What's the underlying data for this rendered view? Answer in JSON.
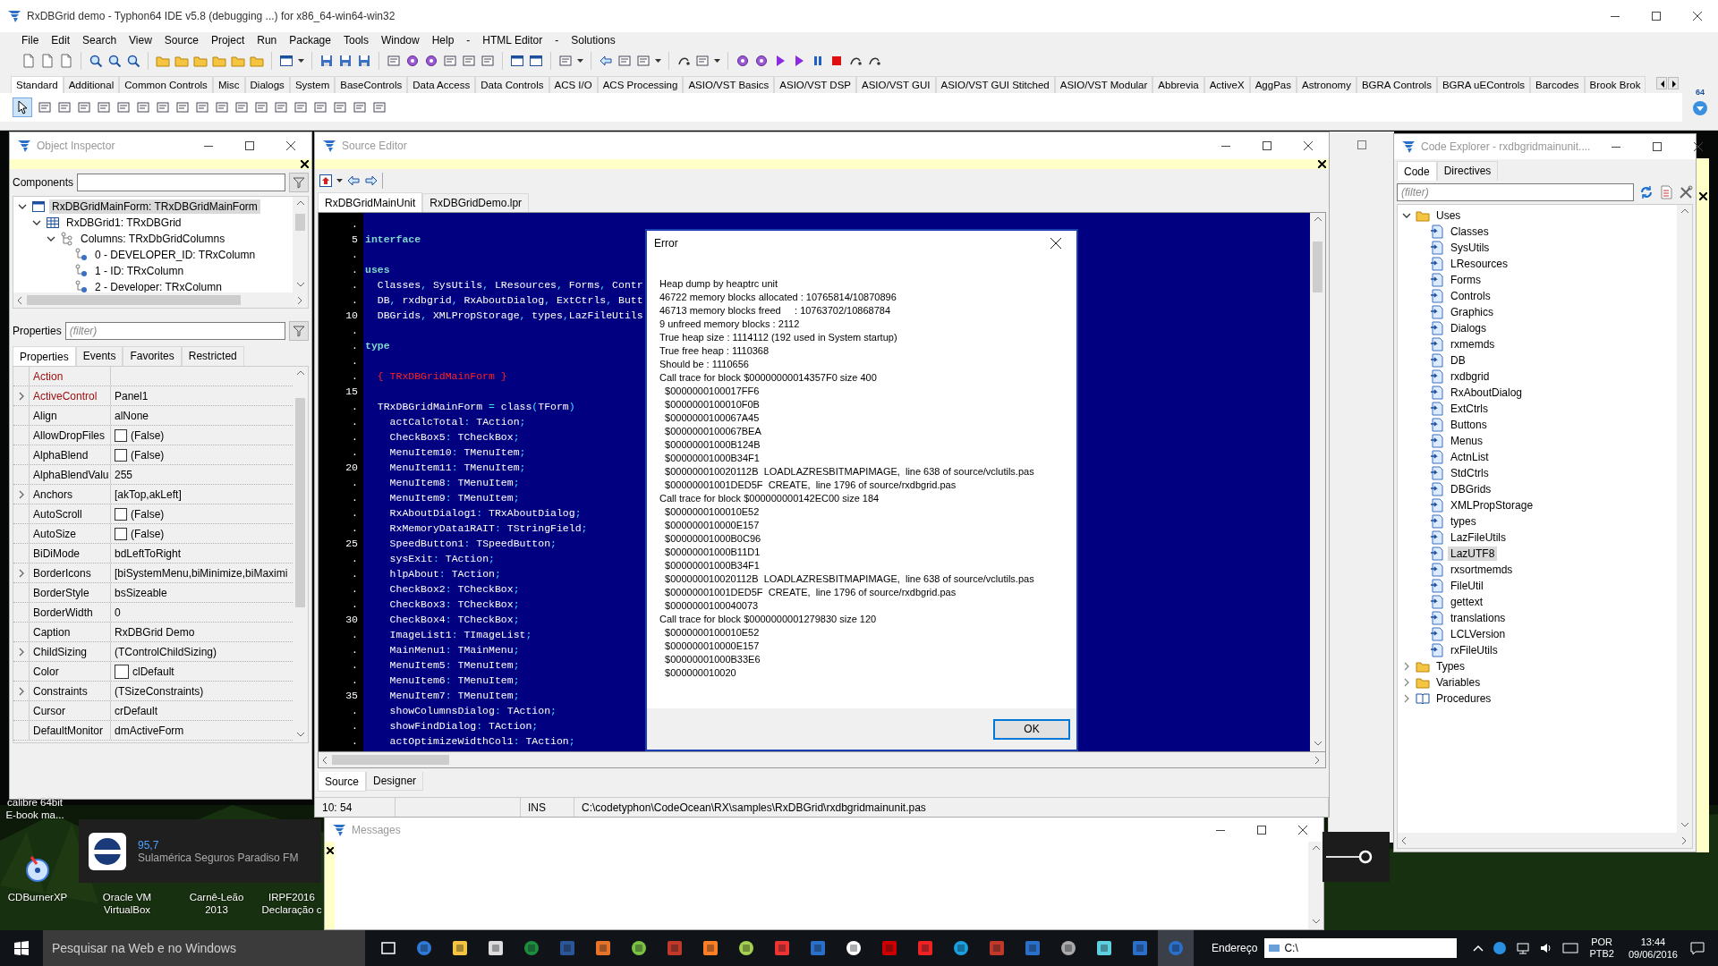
{
  "ide": {
    "title": "RxDBGrid demo - Typhon64 IDE v5.8 (debugging ...) for x86_64-win64-win32",
    "menu": [
      "File",
      "Edit",
      "Search",
      "View",
      "Source",
      "Project",
      "Run",
      "Package",
      "Tools",
      "Window",
      "Help",
      "-",
      "HTML Editor",
      "-",
      "Solutions"
    ],
    "palette_tabs": [
      {
        "label": "Standard",
        "selected": true
      },
      {
        "label": "Additional",
        "selected": false
      },
      {
        "label": "Common Controls",
        "selected": false
      },
      {
        "label": "Misc",
        "selected": false
      },
      {
        "label": "Dialogs",
        "selected": false
      },
      {
        "label": "System",
        "selected": false
      },
      {
        "label": "BaseControls",
        "selected": false
      },
      {
        "label": "Data Access",
        "selected": false
      },
      {
        "label": "Data Controls",
        "selected": false
      },
      {
        "label": "ACS I/O",
        "selected": false
      },
      {
        "label": "ACS Processing",
        "selected": false
      },
      {
        "label": "ASIO/VST Basics",
        "selected": false
      },
      {
        "label": "ASIO/VST DSP",
        "selected": false
      },
      {
        "label": "ASIO/VST GUI",
        "selected": false
      },
      {
        "label": "ASIO/VST GUI Stitched",
        "selected": false
      },
      {
        "label": "ASIO/VST Modular",
        "selected": false
      },
      {
        "label": "Abbrevia",
        "selected": false
      },
      {
        "label": "ActiveX",
        "selected": false
      },
      {
        "label": "AggPas",
        "selected": false
      },
      {
        "label": "Astronomy",
        "selected": false
      },
      {
        "label": "BGRA Controls",
        "selected": false
      },
      {
        "label": "BGRA uEControls",
        "selected": false
      },
      {
        "label": "Barcodes",
        "selected": false
      },
      {
        "label": "Brook Brok",
        "selected": false
      }
    ],
    "badge": "64"
  },
  "object_inspector": {
    "title": "Object Inspector",
    "components_label": "Components",
    "tree": [
      {
        "label": "RxDBGridMainForm: TRxDBGridMainForm",
        "kind": "form",
        "selected": true,
        "expanded": true,
        "children": [
          {
            "label": "RxDBGrid1: TRxDBGrid",
            "kind": "grid",
            "selected": false,
            "expanded": true,
            "children": [
              {
                "label": "Columns: TRxDbGridColumns",
                "kind": "collection",
                "selected": false,
                "expanded": true,
                "children": [
                  {
                    "label": "0 - DEVELOPER_ID: TRxColumn",
                    "kind": "column",
                    "selected": false
                  },
                  {
                    "label": "1 - ID: TRxColumn",
                    "kind": "column",
                    "selected": false
                  },
                  {
                    "label": "2 - Developer: TRxColumn",
                    "kind": "column",
                    "selected": false
                  }
                ]
              }
            ]
          }
        ]
      }
    ],
    "properties_label": "Properties",
    "filter_placeholder": "(filter)",
    "tabs": [
      {
        "label": "Properties",
        "selected": true
      },
      {
        "label": "Events",
        "selected": false
      },
      {
        "label": "Favorites",
        "selected": false
      },
      {
        "label": "Restricted",
        "selected": false
      }
    ],
    "properties": [
      {
        "name": "Action",
        "kind": "text",
        "expandable": false,
        "highlighted": true
      },
      {
        "name": "ActiveControl",
        "value": "Panel1",
        "kind": "text",
        "expandable": true,
        "highlighted": true
      },
      {
        "name": "Align",
        "value": "alNone",
        "kind": "text",
        "expandable": false,
        "highlighted": false
      },
      {
        "name": "AllowDropFiles",
        "value": "(False)",
        "kind": "checkbox",
        "checked": false,
        "expandable": false,
        "highlighted": false
      },
      {
        "name": "AlphaBlend",
        "value": "(False)",
        "kind": "checkbox",
        "checked": false,
        "expandable": false,
        "highlighted": false
      },
      {
        "name": "AlphaBlendValu",
        "value": "255",
        "kind": "text",
        "expandable": false,
        "highlighted": false
      },
      {
        "name": "Anchors",
        "value": "[akTop,akLeft]",
        "kind": "text",
        "expandable": true,
        "highlighted": false
      },
      {
        "name": "AutoScroll",
        "value": "(False)",
        "kind": "checkbox",
        "checked": false,
        "expandable": false,
        "highlighted": false
      },
      {
        "name": "AutoSize",
        "value": "(False)",
        "kind": "checkbox",
        "checked": false,
        "expandable": false,
        "highlighted": false
      },
      {
        "name": "BiDiMode",
        "value": "bdLeftToRight",
        "kind": "text",
        "expandable": false,
        "highlighted": false
      },
      {
        "name": "BorderIcons",
        "value": "[biSystemMenu,biMinimize,biMaximi",
        "kind": "text",
        "expandable": true,
        "highlighted": false
      },
      {
        "name": "BorderStyle",
        "value": "bsSizeable",
        "kind": "text",
        "expandable": false,
        "highlighted": false
      },
      {
        "name": "BorderWidth",
        "value": "0",
        "kind": "text",
        "expandable": false,
        "highlighted": false
      },
      {
        "name": "Caption",
        "value": "RxDBGrid Demo",
        "kind": "text",
        "expandable": false,
        "highlighted": false
      },
      {
        "name": "ChildSizing",
        "value": "(TControlChildSizing)",
        "kind": "text",
        "expandable": true,
        "highlighted": false
      },
      {
        "name": "Color",
        "value": "clDefault",
        "kind": "color",
        "color": "#ffffff",
        "expandable": false,
        "highlighted": false
      },
      {
        "name": "Constraints",
        "value": "(TSizeConstraints)",
        "kind": "text",
        "expandable": true,
        "highlighted": false
      },
      {
        "name": "Cursor",
        "value": "crDefault",
        "kind": "text",
        "expandable": false,
        "highlighted": false
      },
      {
        "name": "DefaultMonitor",
        "value": "dmActiveForm",
        "kind": "text",
        "expandable": false,
        "highlighted": false
      }
    ]
  },
  "source_editor": {
    "title": "Source Editor",
    "tabs": [
      {
        "label": "RxDBGridMainUnit",
        "selected": true
      },
      {
        "label": "RxDBGridDemo.lpr",
        "selected": false
      }
    ],
    "lines": [
      {
        "num": ".",
        "kind": "blank"
      },
      {
        "num": "5",
        "text": "interface",
        "kind": "keyword"
      },
      {
        "num": ".",
        "kind": "blank"
      },
      {
        "num": ".",
        "text": "uses",
        "kind": "keyword"
      },
      {
        "num": ".",
        "text": "  Classes, SysUtils, LResources, Forms, Contr",
        "kind": "code"
      },
      {
        "num": ".",
        "text": "  DB, rxdbgrid, RxAboutDialog, ExtCtrls, Butt",
        "kind": "code"
      },
      {
        "num": "10",
        "text": "  DBGrids, XMLPropStorage, types,LazFileUtils",
        "kind": "code"
      },
      {
        "num": ".",
        "kind": "blank"
      },
      {
        "num": ".",
        "text": "type",
        "kind": "keyword"
      },
      {
        "num": ".",
        "kind": "blank"
      },
      {
        "num": ".",
        "text": "  { TRxDBGridMainForm }",
        "kind": "comment"
      },
      {
        "num": "15",
        "kind": "blank"
      },
      {
        "num": ".",
        "text": "  TRxDBGridMainForm = class(TForm)",
        "kind": "code"
      },
      {
        "num": ".",
        "text": "    actCalcTotal: TAction;",
        "kind": "code"
      },
      {
        "num": ".",
        "text": "    CheckBox5: TCheckBox;",
        "kind": "code"
      },
      {
        "num": ".",
        "text": "    MenuItem10: TMenuItem;",
        "kind": "code"
      },
      {
        "num": "20",
        "text": "    MenuItem11: TMenuItem;",
        "kind": "code"
      },
      {
        "num": ".",
        "text": "    MenuItem8: TMenuItem;",
        "kind": "code"
      },
      {
        "num": ".",
        "text": "    MenuItem9: TMenuItem;",
        "kind": "code"
      },
      {
        "num": ".",
        "text": "    RxAboutDialog1: TRxAboutDialog;",
        "kind": "code"
      },
      {
        "num": ".",
        "text": "    RxMemoryData1RAIT: TStringField;",
        "kind": "code"
      },
      {
        "num": "25",
        "text": "    SpeedButton1: TSpeedButton;",
        "kind": "code"
      },
      {
        "num": ".",
        "text": "    sysExit: TAction;",
        "kind": "code"
      },
      {
        "num": ".",
        "text": "    hlpAbout: TAction;",
        "kind": "code"
      },
      {
        "num": ".",
        "text": "    CheckBox2: TCheckBox;",
        "kind": "code"
      },
      {
        "num": ".",
        "text": "    CheckBox3: TCheckBox;",
        "kind": "code"
      },
      {
        "num": "30",
        "text": "    CheckBox4: TCheckBox;",
        "kind": "code"
      },
      {
        "num": ".",
        "text": "    ImageList1: TImageList;",
        "kind": "code"
      },
      {
        "num": ".",
        "text": "    MainMenu1: TMainMenu;",
        "kind": "code"
      },
      {
        "num": ".",
        "text": "    MenuItem5: TMenuItem;",
        "kind": "code"
      },
      {
        "num": ".",
        "text": "    MenuItem6: TMenuItem;",
        "kind": "code"
      },
      {
        "num": "35",
        "text": "    MenuItem7: TMenuItem;",
        "kind": "code"
      },
      {
        "num": ".",
        "text": "    showColumnsDialog: TAction;",
        "kind": "code"
      },
      {
        "num": ".",
        "text": "    showFindDialog: TAction;",
        "kind": "code"
      },
      {
        "num": ".",
        "text": "    actOptimizeWidthCol1: TAction;",
        "kind": "code"
      }
    ],
    "bottom_tabs": [
      {
        "label": "Source",
        "selected": true
      },
      {
        "label": "Designer",
        "selected": false
      }
    ],
    "status": {
      "position": "10: 54",
      "mode": "INS",
      "path": "C:\\codetyphon\\CodeOcean\\RX\\samples\\RxDBGrid\\rxdbgridmainunit.pas"
    }
  },
  "error_dialog": {
    "title": "Error",
    "lines": [
      "Heap dump by heaptrc unit",
      "46722 memory blocks allocated : 10765814/10870896",
      "46713 memory blocks freed     : 10763702/10868784",
      "9 unfreed memory blocks : 2112",
      "True heap size : 1114112 (192 used in System startup)",
      "True free heap : 1110368",
      "Should be : 1110656",
      "Call trace for block $00000000014357F0 size 400",
      "  $0000000100017FF6",
      "  $0000000100010F0B",
      "  $0000000100067A45",
      "  $0000000100067BEA",
      "  $00000001000B124B",
      "  $00000001000B34F1",
      "  $000000010020112B  LOADLAZRESBITMAPIMAGE,  line 638 of source/vclutils.pas",
      "  $00000001001DED5F  CREATE,  line 1796 of source/rxdbgrid.pas",
      "Call trace for block $000000000142EC00 size 184",
      "  $0000000100010E52",
      "  $000000010000E157",
      "  $00000001000B0C96",
      "  $00000001000B11D1",
      "  $00000001000B34F1",
      "  $000000010020112B  LOADLAZRESBITMAPIMAGE,  line 638 of source/vclutils.pas",
      "  $00000001001DED5F  CREATE,  line 1796 of source/rxdbgrid.pas",
      "  $0000000100040073",
      "Call trace for block $0000000001279830 size 120",
      "  $0000000100010E52",
      "  $000000010000E157",
      "  $00000001000B33E6",
      "  $000000010020"
    ],
    "button": "OK"
  },
  "code_explorer": {
    "title": "Code Explorer - rxdbgridmainunit....",
    "tabs": [
      {
        "label": "Code",
        "selected": true
      },
      {
        "label": "Directives",
        "selected": false
      }
    ],
    "filter_placeholder": "(filter)",
    "tree": [
      {
        "label": "Uses",
        "kind": "folder",
        "expanded": true,
        "selected": false,
        "children": [
          {
            "label": "Classes",
            "kind": "unit",
            "selected": false
          },
          {
            "label": "SysUtils",
            "kind": "unit",
            "selected": false
          },
          {
            "label": "LResources",
            "kind": "unit",
            "selected": false
          },
          {
            "label": "Forms",
            "kind": "unit",
            "selected": false
          },
          {
            "label": "Controls",
            "kind": "unit",
            "selected": false
          },
          {
            "label": "Graphics",
            "kind": "unit",
            "selected": false
          },
          {
            "label": "Dialogs",
            "kind": "unit",
            "selected": false
          },
          {
            "label": "rxmemds",
            "kind": "unit",
            "selected": false
          },
          {
            "label": "DB",
            "kind": "unit",
            "selected": false
          },
          {
            "label": "rxdbgrid",
            "kind": "unit",
            "selected": false
          },
          {
            "label": "RxAboutDialog",
            "kind": "unit",
            "selected": false
          },
          {
            "label": "ExtCtrls",
            "kind": "unit",
            "selected": false
          },
          {
            "label": "Buttons",
            "kind": "unit",
            "selected": false
          },
          {
            "label": "Menus",
            "kind": "unit",
            "selected": false
          },
          {
            "label": "ActnList",
            "kind": "unit",
            "selected": false
          },
          {
            "label": "StdCtrls",
            "kind": "unit",
            "selected": false
          },
          {
            "label": "DBGrids",
            "kind": "unit",
            "selected": false
          },
          {
            "label": "XMLPropStorage",
            "kind": "unit",
            "selected": false
          },
          {
            "label": "types",
            "kind": "unit",
            "selected": false
          },
          {
            "label": "LazFileUtils",
            "kind": "unit",
            "selected": false
          },
          {
            "label": "LazUTF8",
            "kind": "unit",
            "selected": true
          },
          {
            "label": "rxsortmemds",
            "kind": "unit",
            "selected": false
          },
          {
            "label": "FileUtil",
            "kind": "unit",
            "selected": false
          },
          {
            "label": "gettext",
            "kind": "unit",
            "selected": false
          },
          {
            "label": "translations",
            "kind": "unit",
            "selected": false
          },
          {
            "label": "LCLVersion",
            "kind": "unit",
            "selected": false
          },
          {
            "label": "rxFileUtils",
            "kind": "unit",
            "selected": false
          }
        ]
      },
      {
        "label": "Types",
        "kind": "folder",
        "expanded": false,
        "selected": false
      },
      {
        "label": "Variables",
        "kind": "folder",
        "expanded": false,
        "selected": false
      },
      {
        "label": "Procedures",
        "kind": "book",
        "expanded": false,
        "selected": false
      }
    ]
  },
  "messages": {
    "title": "Messages"
  },
  "desktop_icons": [
    {
      "label": "calibre 64bit E-book ma...",
      "kind": "hidden"
    },
    {
      "label": "CDBurnerXP",
      "kind": "cd"
    },
    {
      "label": "Oracle VM VirtualBox",
      "kind": "hidden"
    },
    {
      "label": "Carnê-Leão 2013",
      "kind": "hidden"
    },
    {
      "label": "IRPF2016 Declaração c",
      "kind": "hidden"
    }
  ],
  "notification": {
    "title": "95,7",
    "text": "Sulamérica Seguros Paradiso FM"
  },
  "taskbar": {
    "search_placeholder": "Pesquisar na Web e no Windows",
    "address_label": "Endereço",
    "address_value": "C:\\",
    "language": "POR",
    "layout": "PTB2",
    "time": "13:44",
    "date": "09/06/2016"
  }
}
